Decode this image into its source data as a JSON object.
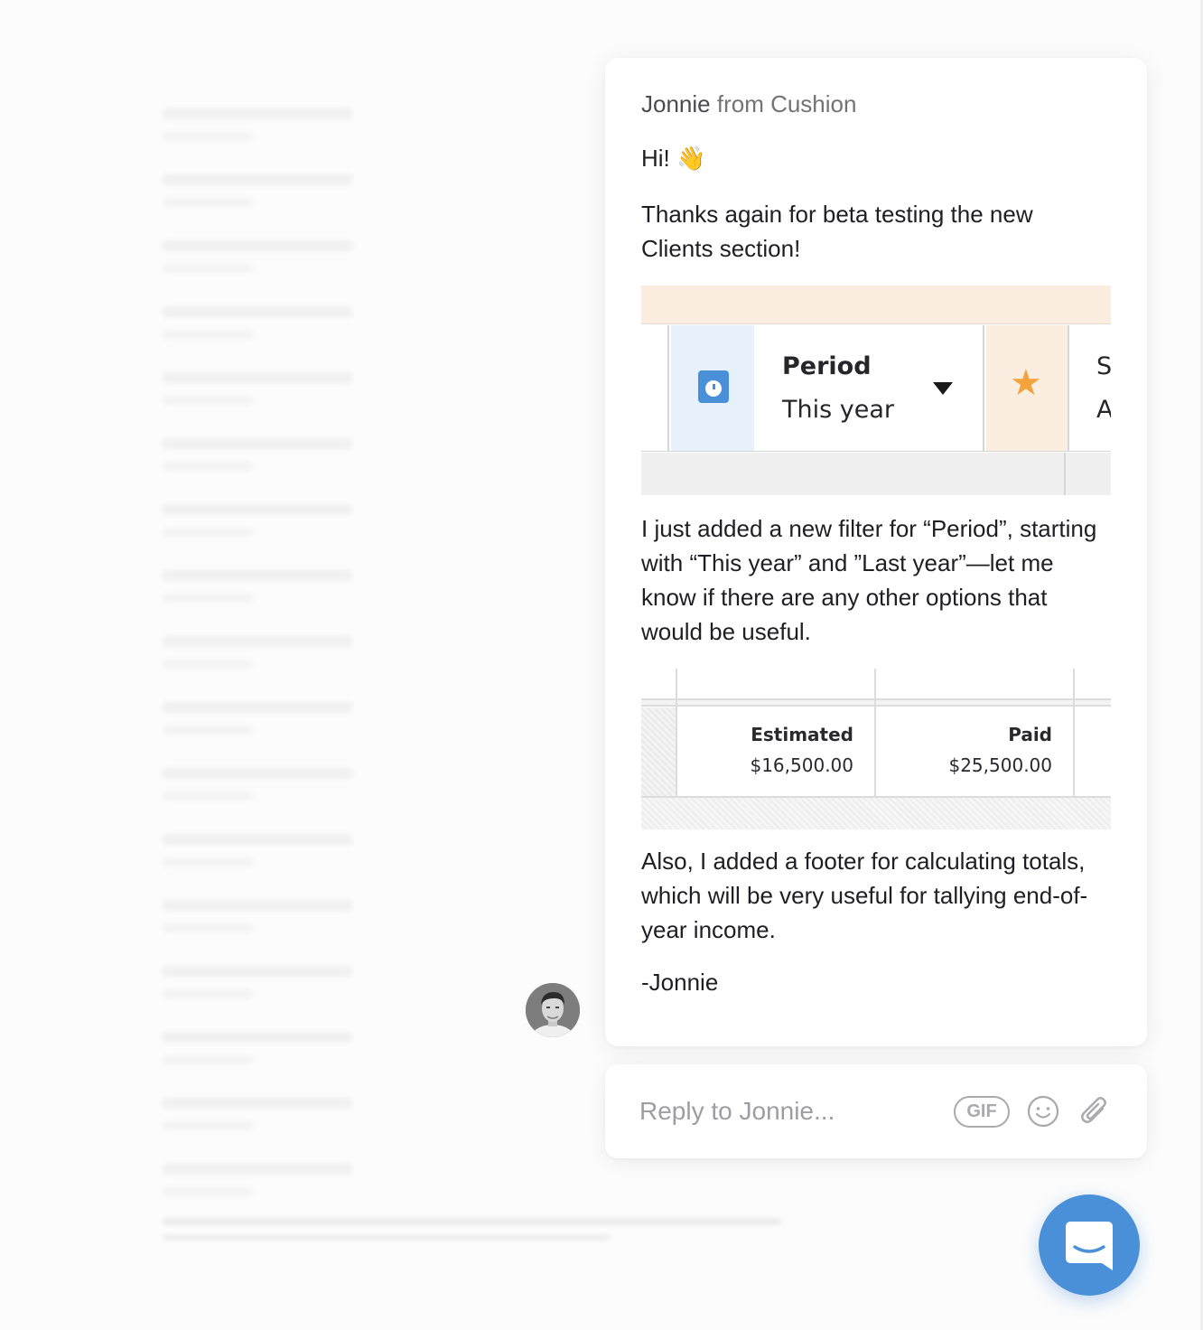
{
  "conversation": {
    "sender_name": "Jonnie",
    "sender_suffix": " from Cushion",
    "greeting": "Hi!",
    "wave_emoji": "👋",
    "paragraph_1": "Thanks again for beta testing the new Clients section!",
    "paragraph_2": "I just added a new filter for “Period”, starting with “This year” and ”Last year”—let me know if there are any other options that would be useful.",
    "paragraph_3": "Also, I added a footer for calculating totals, which will be very useful for tallying end-of-year income.",
    "signature": "-Jonnie"
  },
  "filter_preview": {
    "label": "Period",
    "value": "This year",
    "cut_label_top": "S",
    "cut_label_bottom": "A",
    "icons": [
      "calendar-clock-icon",
      "dropdown-caret-icon",
      "star-icon"
    ],
    "colors": {
      "header_bg": "#fbeee1",
      "icon_bg": "#e6f1fb",
      "accent": "#4a90d9",
      "star": "#f3a33b"
    }
  },
  "totals_preview": {
    "columns": [
      {
        "header": "Estimated",
        "value": "$16,500.00"
      },
      {
        "header": "Paid",
        "value": "$25,500.00"
      }
    ]
  },
  "reply": {
    "placeholder": "Reply to Jonnie...",
    "gif_label": "GIF",
    "icons": [
      "emoji-icon",
      "paperclip-icon"
    ]
  },
  "launcher": {
    "icon": "chat-bubble-icon",
    "color": "#4a90d9"
  }
}
